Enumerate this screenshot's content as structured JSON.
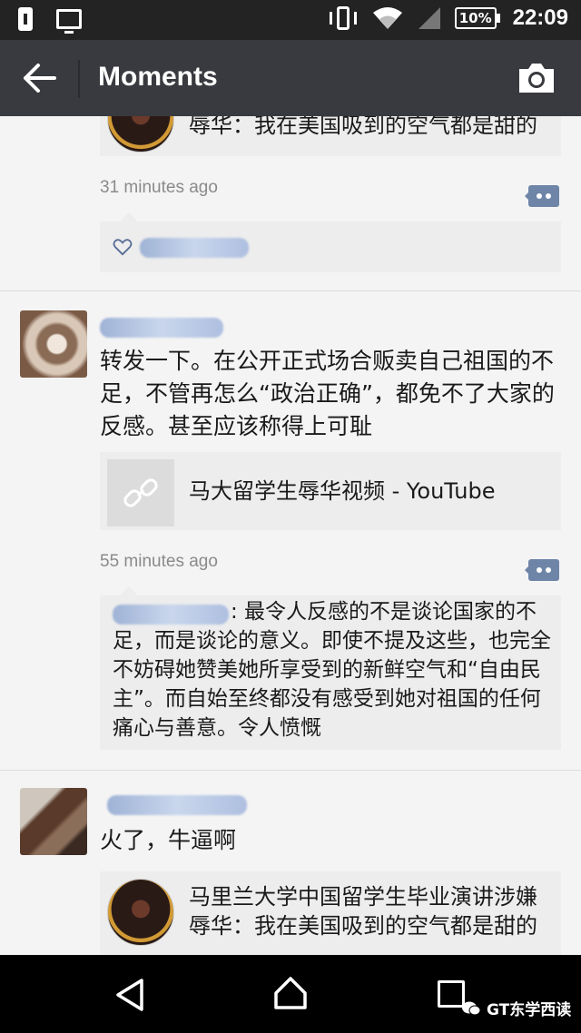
{
  "status_bar": {
    "battery_percent": "10%",
    "time": "22:09",
    "icons": [
      "battery-saver-icon",
      "screen-cast-icon",
      "vibrate-icon",
      "wifi-icon",
      "signal-icon",
      "battery-icon"
    ]
  },
  "app_bar": {
    "title": "Moments",
    "back_icon": "arrow-left-icon",
    "camera_icon": "camera-icon"
  },
  "posts": [
    {
      "partial": true,
      "link_card": {
        "title_line2": "辱华：我在美国吸到的空气都是甜的"
      },
      "time": "31 minutes ago",
      "likes": {
        "icon": "heart-icon",
        "names_blurred": true
      }
    },
    {
      "author_blurred": true,
      "text": "转发一下。在公开正式场合贩卖自己祖国的不足，不管再怎么“政治正确”，都免不了大家的反感。甚至应该称得上可耻",
      "link_card": {
        "icon": "link-icon",
        "title": "马大留学生辱华视频 - YouTube"
      },
      "time": "55 minutes ago",
      "comment": {
        "author_blurred": true,
        "text": ": 最令人反感的不是谈论国家的不足，而是谈论的意义。即使不提及这些，也完全不妨碍她赞美她所享受到的新鲜空气和“自由民主”。而自始至终都没有感受到她对祖国的任何痛心与善意。令人愤慨"
      }
    },
    {
      "author_blurred": true,
      "text": "火了，牛逼啊",
      "link_card": {
        "title_line1": "马里兰大学中国留学生毕业演讲涉嫌",
        "title_line2": "辱华：我在美国吸到的空气都是甜的"
      }
    }
  ],
  "nav_bar": {
    "icons": [
      "nav-back-icon",
      "nav-home-icon",
      "nav-recents-icon"
    ],
    "watermark": "GT东学西读"
  },
  "colors": {
    "app_bar": "#393a3f",
    "status_bar": "#232323",
    "background": "#f4f4f4",
    "card": "#ededed",
    "accent_blue": "#576b95"
  }
}
